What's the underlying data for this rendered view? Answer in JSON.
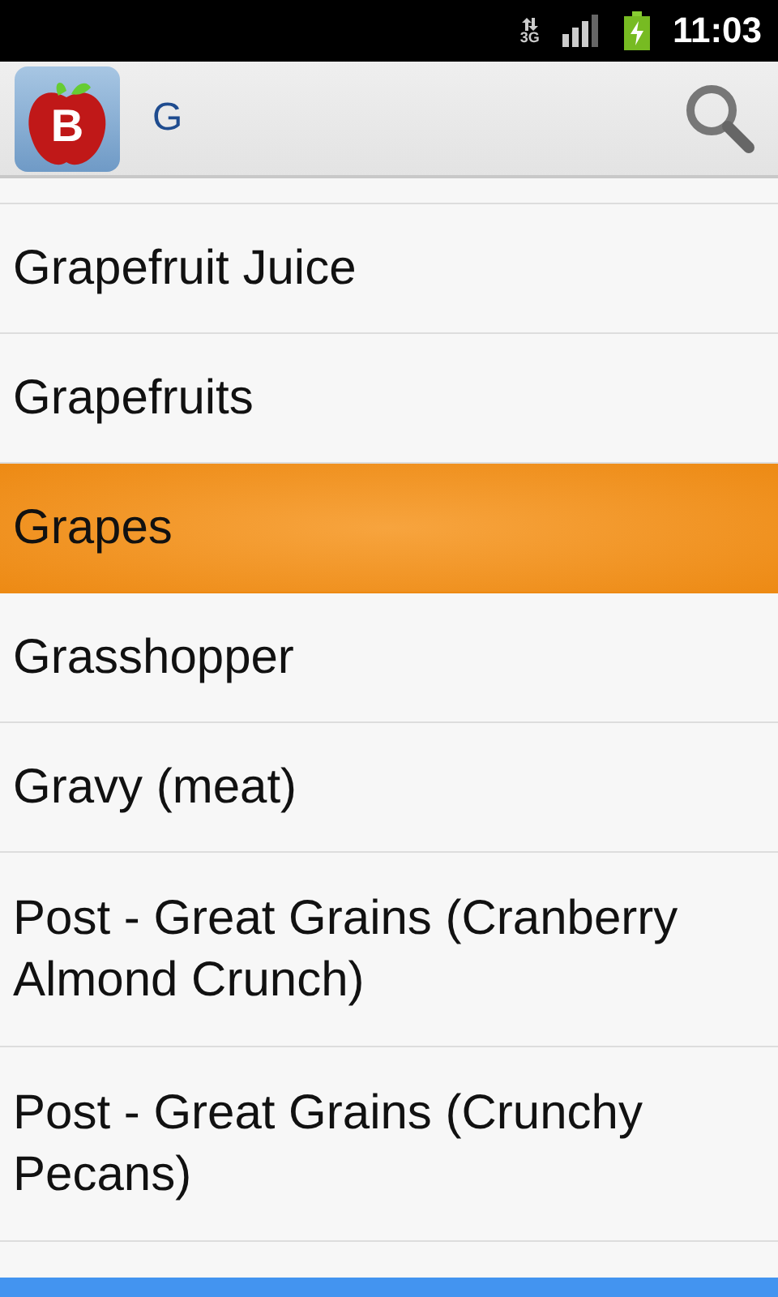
{
  "status_bar": {
    "network_type": "3G",
    "time": "11:03"
  },
  "action_bar": {
    "logo_letter": "B",
    "query": "G"
  },
  "items": [
    {
      "label": "Grapefruit Juice",
      "selected": false
    },
    {
      "label": "Grapefruits",
      "selected": false
    },
    {
      "label": "Grapes",
      "selected": true
    },
    {
      "label": "Grasshopper",
      "selected": false
    },
    {
      "label": "Gravy (meat)",
      "selected": false
    },
    {
      "label": "Post - Great Grains (Cranberry Almond Crunch)",
      "selected": false
    },
    {
      "label": "Post - Great Grains (Crunchy Pecans)",
      "selected": false
    }
  ]
}
